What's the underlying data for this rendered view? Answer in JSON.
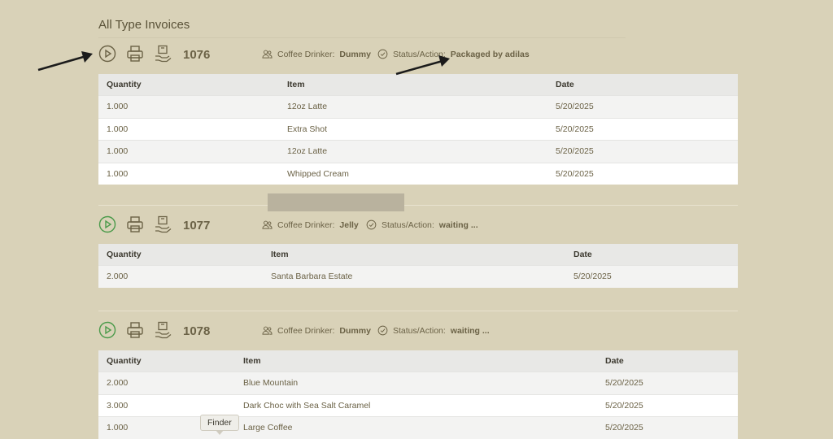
{
  "page_title": "All Type Invoices",
  "tooltip": "Finder",
  "columns": [
    "Quantity",
    "Item",
    "Date"
  ],
  "invoices": [
    {
      "number": "1076",
      "drinker_label": "Coffee Drinker:",
      "drinker": "Dummy",
      "status_label": "Status/Action:",
      "status": "Packaged by adilas",
      "play_color": "#6b6246",
      "rows": [
        {
          "qty": "1.000",
          "item": "12oz Latte",
          "date": "5/20/2025"
        },
        {
          "qty": "1.000",
          "item": "Extra Shot",
          "date": "5/20/2025"
        },
        {
          "qty": "1.000",
          "item": "12oz Latte",
          "date": "5/20/2025"
        },
        {
          "qty": "1.000",
          "item": "Whipped Cream",
          "date": "5/20/2025"
        }
      ]
    },
    {
      "number": "1077",
      "drinker_label": "Coffee Drinker:",
      "drinker": "Jelly",
      "status_label": "Status/Action:",
      "status": "waiting ...",
      "play_color": "#4a9a4a",
      "rows": [
        {
          "qty": "2.000",
          "item": "Santa Barbara Estate",
          "date": "5/20/2025"
        }
      ]
    },
    {
      "number": "1078",
      "drinker_label": "Coffee Drinker:",
      "drinker": "Dummy",
      "status_label": "Status/Action:",
      "status": "waiting ...",
      "play_color": "#4a9a4a",
      "rows": [
        {
          "qty": "2.000",
          "item": "Blue Mountain",
          "date": "5/20/2025"
        },
        {
          "qty": "3.000",
          "item": "Dark Choc with Sea Salt Caramel",
          "date": "5/20/2025"
        },
        {
          "qty": "1.000",
          "item": "Large Coffee",
          "date": "5/20/2025"
        }
      ]
    }
  ]
}
